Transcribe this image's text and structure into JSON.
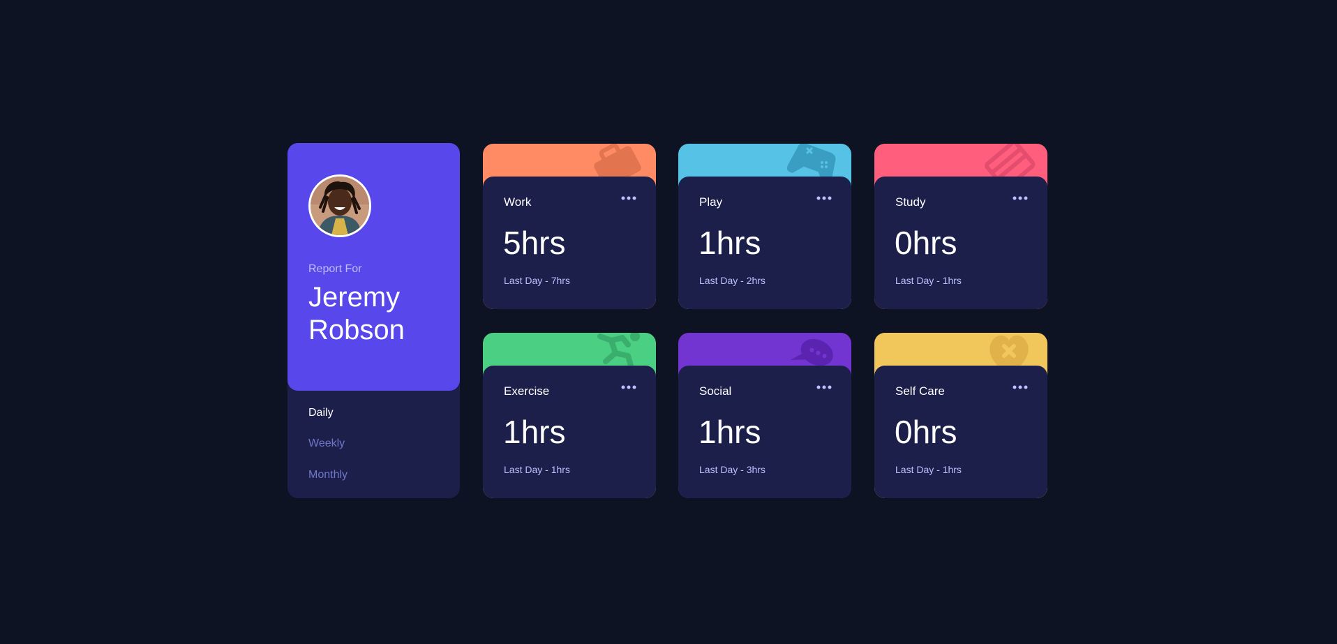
{
  "profile": {
    "report_label": "Report For",
    "user_name": "Jeremy Robson",
    "periods": [
      {
        "label": "Daily",
        "active": true
      },
      {
        "label": "Weekly",
        "active": false
      },
      {
        "label": "Monthly",
        "active": false
      }
    ]
  },
  "colors": {
    "background": "#0e1323",
    "card": "#1c1f4a",
    "profile_accent": "#5847eb",
    "work": "#ff8b64",
    "play": "#55c2e6",
    "study": "#ff5e7d",
    "exercise": "#4bcf82",
    "social": "#7335d2",
    "self_care": "#f1c75b"
  },
  "activities": [
    {
      "title": "Work",
      "hours": "5hrs",
      "previous": "Last Day - 7hrs",
      "icon": "briefcase-icon"
    },
    {
      "title": "Play",
      "hours": "1hrs",
      "previous": "Last Day - 2hrs",
      "icon": "gamepad-icon"
    },
    {
      "title": "Study",
      "hours": "0hrs",
      "previous": "Last Day - 1hrs",
      "icon": "book-icon"
    },
    {
      "title": "Exercise",
      "hours": "1hrs",
      "previous": "Last Day - 1hrs",
      "icon": "running-icon"
    },
    {
      "title": "Social",
      "hours": "1hrs",
      "previous": "Last Day - 3hrs",
      "icon": "chat-bubble-icon"
    },
    {
      "title": "Self Care",
      "hours": "0hrs",
      "previous": "Last Day - 1hrs",
      "icon": "heart-icon"
    }
  ]
}
